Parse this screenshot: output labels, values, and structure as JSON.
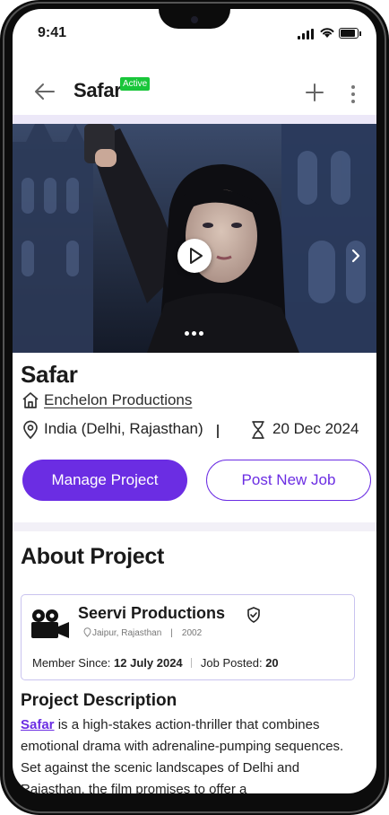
{
  "status_bar": {
    "time": "9:41"
  },
  "header": {
    "title": "Safar",
    "badge": "Active",
    "back_icon": "arrow-left-icon",
    "add_icon": "plus-icon",
    "more_icon": "more-vertical-icon"
  },
  "hero": {
    "play_icon": "play-icon",
    "next_icon": "chevron-right-icon"
  },
  "project": {
    "name": "Safar",
    "company": "Enchelon Productions",
    "location": "India (Delhi, Rajasthan)",
    "date": "20 Dec 2024"
  },
  "actions": {
    "manage": "Manage Project",
    "post_job": "Post New Job"
  },
  "about": {
    "title": "About Project",
    "card": {
      "name": "Seervi Productions",
      "location": "Jaipur, Rajasthan",
      "year": "2002",
      "member_label": "Member Since:",
      "member_value": "12 July 2024",
      "jobs_label": "Job Posted:",
      "jobs_value": "20"
    },
    "desc_title": "Project Description",
    "desc_link": "Safar",
    "desc_text": " is a high-stakes action-thriller that combines emotional drama with adrenaline-pumping sequences. Set against the scenic landscapes of Delhi and Rajasthan, the film promises to offer a"
  },
  "colors": {
    "accent": "#6b2de3",
    "badge": "#19c63a",
    "card_border": "#c9c3ef"
  }
}
